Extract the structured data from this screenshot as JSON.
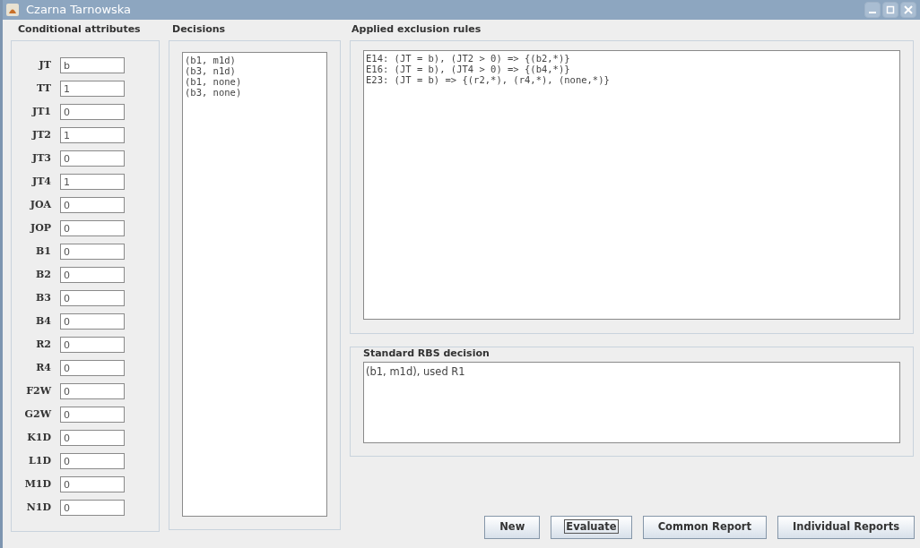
{
  "window": {
    "title": "Czarna Tarnowska",
    "controls": [
      {
        "kind": "minimize"
      },
      {
        "kind": "maximize"
      },
      {
        "kind": "close"
      }
    ]
  },
  "conditional_attributes": {
    "title": "Conditional attributes",
    "fields": [
      {
        "label": "JT",
        "value": "b"
      },
      {
        "label": "TT",
        "value": "1"
      },
      {
        "label": "JT1",
        "value": "0"
      },
      {
        "label": "JT2",
        "value": "1"
      },
      {
        "label": "JT3",
        "value": "0"
      },
      {
        "label": "JT4",
        "value": "1"
      },
      {
        "label": "JOA",
        "value": "0"
      },
      {
        "label": "JOP",
        "value": "0"
      },
      {
        "label": "B1",
        "value": "0"
      },
      {
        "label": "B2",
        "value": "0"
      },
      {
        "label": "B3",
        "value": "0"
      },
      {
        "label": "B4",
        "value": "0"
      },
      {
        "label": "R2",
        "value": "0"
      },
      {
        "label": "R4",
        "value": "0"
      },
      {
        "label": "F2W",
        "value": "0"
      },
      {
        "label": "G2W",
        "value": "0"
      },
      {
        "label": "K1D",
        "value": "0"
      },
      {
        "label": "L1D",
        "value": "0"
      },
      {
        "label": "M1D",
        "value": "0"
      },
      {
        "label": "N1D",
        "value": "0"
      }
    ]
  },
  "decisions": {
    "title": "Decisions",
    "items": [
      "(b1, m1d)",
      "(b3, n1d)",
      "(b1, none)",
      "(b3, none)"
    ]
  },
  "applied_exclusion_rules": {
    "title": "Applied exclusion rules",
    "lines": [
      "E14: (JT = b), (JT2 > 0) => {(b2,*)}",
      "E16: (JT = b), (JT4 > 0) => {(b4,*)}",
      "E23: (JT = b) => {(r2,*), (r4,*), (none,*)}"
    ]
  },
  "standard_rbs_decision": {
    "title": "Standard RBS decision",
    "text": "(b1, m1d), used R1"
  },
  "buttons": [
    {
      "label": "New",
      "focused": false
    },
    {
      "label": "Evaluate",
      "focused": true
    },
    {
      "label": "Common Report",
      "focused": false
    },
    {
      "label": "Individual Reports",
      "focused": false
    }
  ]
}
